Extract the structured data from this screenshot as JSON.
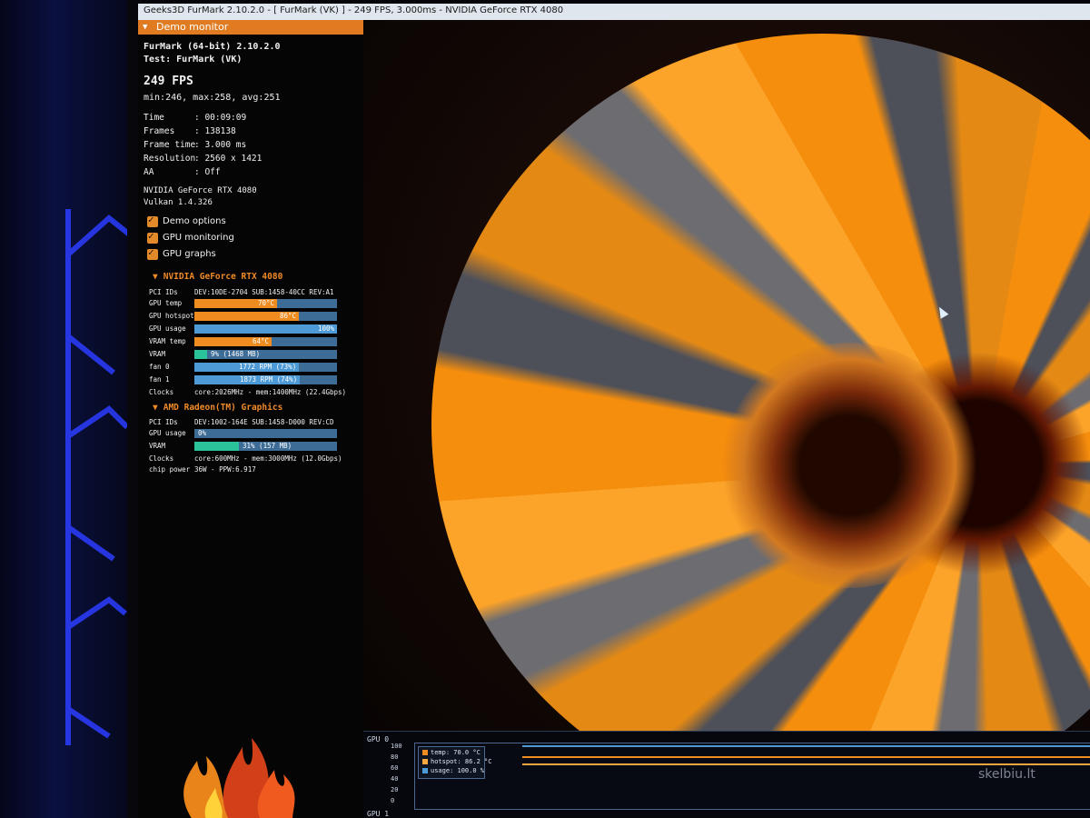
{
  "window": {
    "title": "Geeks3D FurMark 2.10.2.0 - [ FurMark (VK) ] - 249 FPS, 3.000ms - NVIDIA GeForce RTX 4080"
  },
  "panel": {
    "header": "Demo monitor",
    "app_line": "FurMark (64-bit) 2.10.2.0",
    "test_line": "Test: FurMark (VK)",
    "fps": "249 FPS",
    "fps_stats": "min:246, max:258, avg:251",
    "stats": [
      {
        "key": "Time",
        "value": ": 00:09:09"
      },
      {
        "key": "Frames",
        "value": ": 138138"
      },
      {
        "key": "Frame time",
        "value": ": 3.000 ms"
      },
      {
        "key": "Resolution",
        "value": ": 2560 x 1421"
      },
      {
        "key": "AA",
        "value": ": Off"
      }
    ],
    "gpu_name": "NVIDIA GeForce RTX 4080",
    "api": "Vulkan 1.4.326",
    "options": [
      {
        "label": "Demo options",
        "checked": true
      },
      {
        "label": "GPU monitoring",
        "checked": true
      },
      {
        "label": "GPU graphs",
        "checked": true
      }
    ],
    "gpu0": {
      "title": "NVIDIA GeForce RTX 4080",
      "pci_label": "PCI IDs",
      "pci_value": "DEV:10DE-2704 SUB:1458-40CC REV:A1",
      "bars": [
        {
          "label": "GPU temp",
          "text": "70°C",
          "fill": 0.58,
          "color": "#ee8c1f"
        },
        {
          "label": "GPU hotspot",
          "text": "86°C",
          "fill": 0.73,
          "color": "#ee8c1f"
        },
        {
          "label": "GPU usage",
          "text": "100%",
          "fill": 1.0,
          "color": "#4e9ad6"
        },
        {
          "label": "VRAM temp",
          "text": "64°C",
          "fill": 0.54,
          "color": "#ee8c1f"
        },
        {
          "label": "VRAM",
          "text": "9% (1468 MB)",
          "fill": 0.09,
          "color": "#2bc49a"
        },
        {
          "label": "fan 0",
          "text": "1772 RPM (73%)",
          "fill": 0.73,
          "color": "#4e9ad6"
        },
        {
          "label": "fan 1",
          "text": "1873 RPM (74%)",
          "fill": 0.74,
          "color": "#4e9ad6"
        }
      ],
      "clocks_label": "Clocks",
      "clocks_value": "core:2026MHz - mem:1400MHz (22.4Gbps)"
    },
    "gpu1": {
      "title": "AMD Radeon(TM) Graphics",
      "pci_label": "PCI IDs",
      "pci_value": "DEV:1002-164E SUB:1458-D000 REV:CD",
      "bars": [
        {
          "label": "GPU usage",
          "text": "0%",
          "fill": 0.0,
          "color": "#4e9ad6"
        },
        {
          "label": "VRAM",
          "text": "31% (157 MB)",
          "fill": 0.31,
          "color": "#2bc49a"
        }
      ],
      "clocks_label": "Clocks",
      "clocks_value": "core:600MHz - mem:3000MHz (12.0Gbps)",
      "power_label": "chip power",
      "power_value": "36W - PPW:6.917"
    }
  },
  "graph": {
    "title": "GPU 0",
    "title2": "GPU 1",
    "y_ticks": [
      "100",
      "80",
      "60",
      "40",
      "20",
      "0"
    ],
    "legend": [
      {
        "label": "temp: 70.0 °C",
        "color": "#ee8c1f"
      },
      {
        "label": "hotspot: 86.2 °C",
        "color": "#f4a640"
      },
      {
        "label": "usage: 100.0 %",
        "color": "#4e9ad6"
      }
    ],
    "watermark": "skelbiu.lt"
  }
}
